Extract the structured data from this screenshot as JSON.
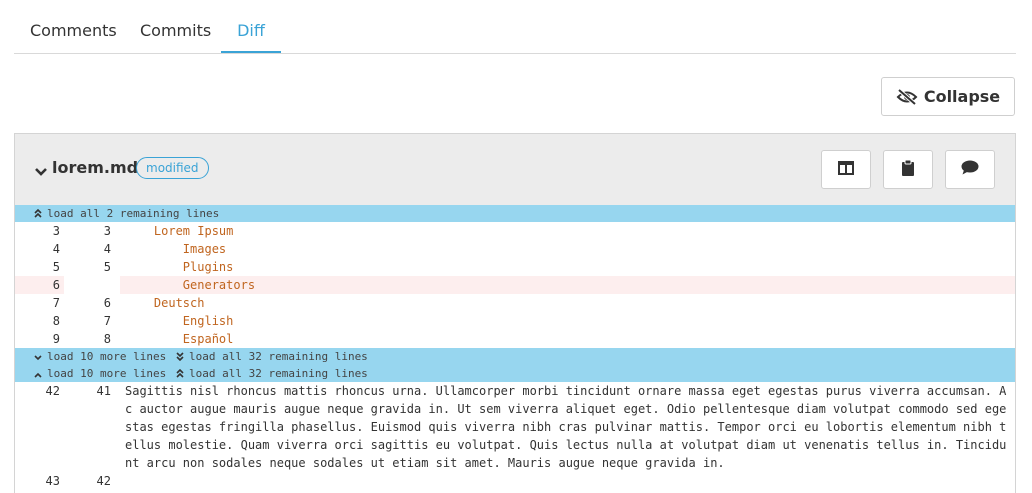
{
  "tabs": [
    {
      "label": "Comments",
      "active": false
    },
    {
      "label": "Commits",
      "active": false
    },
    {
      "label": "Diff",
      "active": true
    }
  ],
  "toolbar": {
    "collapse_label": "Collapse"
  },
  "file": {
    "name": "lorem.md",
    "status": "modified",
    "actions": [
      "view-split-icon",
      "clipboard-icon",
      "comment-icon"
    ]
  },
  "loaders": {
    "top": "load all 2 remaining lines",
    "more": "load 10 more lines",
    "all_below": "load all 32 remaining lines",
    "more_up": "load 10 more lines",
    "all_above": "load all 32 remaining lines"
  },
  "diff_lines": [
    {
      "old": "3",
      "new": "3",
      "text": "    Lorem Ipsum",
      "type": "context"
    },
    {
      "old": "4",
      "new": "4",
      "text": "        Images",
      "type": "context"
    },
    {
      "old": "5",
      "new": "5",
      "text": "        Plugins",
      "type": "context"
    },
    {
      "old": "6",
      "new": "",
      "text": "        Generators",
      "type": "deleted"
    },
    {
      "old": "7",
      "new": "6",
      "text": "    Deutsch",
      "type": "context"
    },
    {
      "old": "8",
      "new": "7",
      "text": "        English",
      "type": "context"
    },
    {
      "old": "9",
      "new": "8",
      "text": "        Español",
      "type": "context"
    }
  ],
  "prose_lines": [
    {
      "old": "42",
      "new": "41",
      "text": "Sagittis nisl rhoncus mattis rhoncus urna. Ullamcorper morbi tincidunt ornare massa eget egestas purus viverra accumsan. Ac auctor augue mauris augue neque gravida in. Ut sem viverra aliquet eget. Odio pellentesque diam volutpat commodo sed egestas egestas fringilla phasellus. Euismod quis viverra nibh cras pulvinar mattis. Tempor orci eu lobortis elementum nibh tellus molestie. Quam viverra orci sagittis eu volutpat. Quis lectus nulla at volutpat diam ut venenatis tellus in. Tincidunt arcu non sodales neque sodales ut etiam sit amet. Mauris augue neque gravida in."
    },
    {
      "old": "43",
      "new": "42",
      "text": ""
    }
  ]
}
